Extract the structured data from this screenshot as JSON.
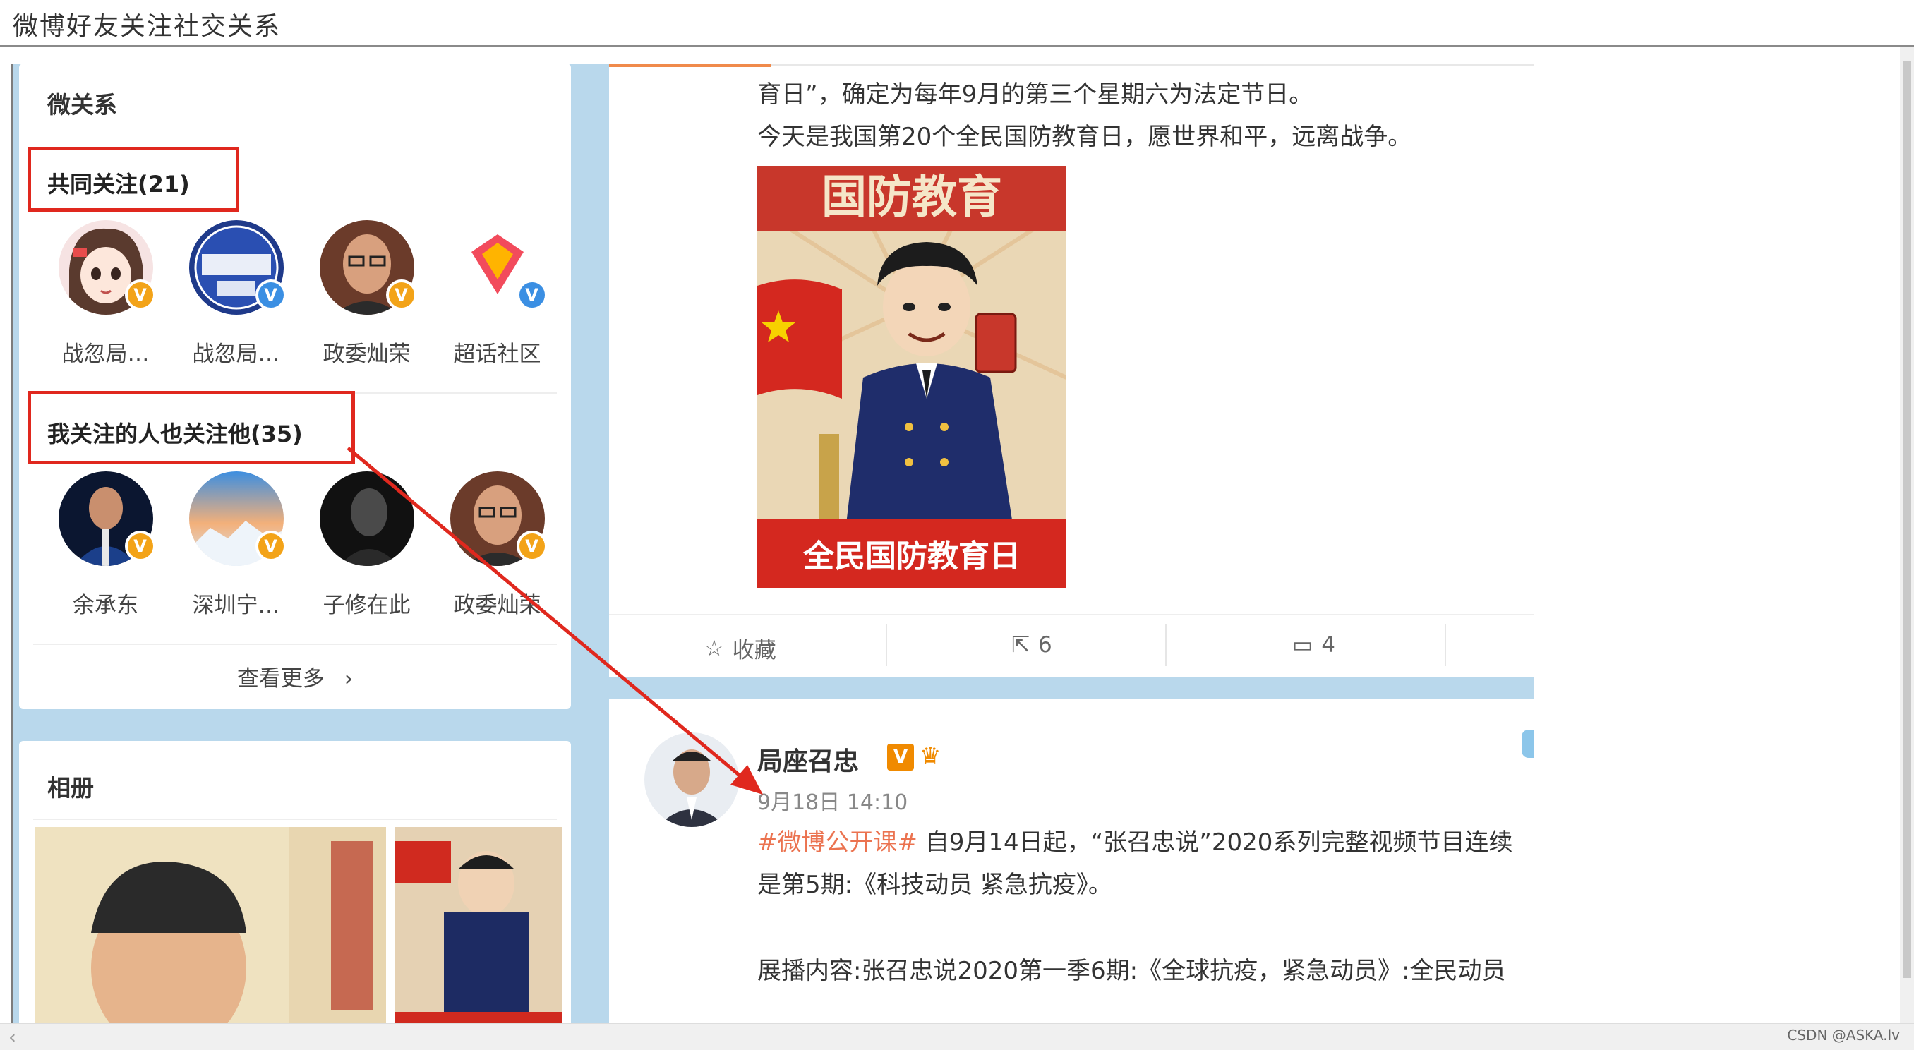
{
  "window": {
    "title": "微博好友关注社交关系"
  },
  "left": {
    "relation_title": "微关系",
    "common_follow": {
      "title": "共同关注(21)",
      "people": [
        {
          "name": "战忽局…",
          "badge": "gold",
          "avatar": "anime-girl"
        },
        {
          "name": "战忽局…",
          "badge": "blue",
          "avatar": "sf-logo"
        },
        {
          "name": "政委灿荣",
          "badge": "gold",
          "avatar": "man-glasses"
        },
        {
          "name": "超话社区",
          "badge": "blue",
          "avatar": "diamond-logo"
        }
      ]
    },
    "followed_also": {
      "title": "我关注的人也关注他(35)",
      "people": [
        {
          "name": "余承东",
          "badge": "gold",
          "avatar": "man-stage"
        },
        {
          "name": "深圳宁…",
          "badge": "gold",
          "avatar": "sky-mountain"
        },
        {
          "name": "子修在此",
          "badge": "none",
          "avatar": "dark-portrait"
        },
        {
          "name": "政委灿荣",
          "badge": "gold",
          "avatar": "man-glasses"
        }
      ]
    },
    "see_more": "查看更多",
    "album_title": "相册"
  },
  "feed": {
    "post1": {
      "line1": "育日”，确定为每年9月的第三个星期六为法定节日。",
      "line2": "今天是我国第20个全民国防教育日，愿世界和平，远离战争。",
      "poster_top_text": "国防教育",
      "poster_bottom_text": "全民国防教育日",
      "actions": {
        "favorite": "收藏",
        "repost": "6",
        "comment": "4"
      }
    },
    "post2": {
      "author": "局座召忠",
      "time": "9月18日 14:10",
      "topic": "#微博公开课#",
      "text1": " 自9月14日起，“张召忠说”2020系列完整视频节目连续",
      "text2": "是第5期:《科技动员 紧急抗疫》。",
      "text3": "展播内容:张召忠说2020第一季6期:《全球抗疫，紧急动员》:全民动员"
    }
  },
  "watermark": "CSDN @ASKA.lv",
  "colors": {
    "highlight_red": "#e0281e",
    "topic_orange": "#eb7350",
    "page_blue": "#b9d8ec"
  }
}
